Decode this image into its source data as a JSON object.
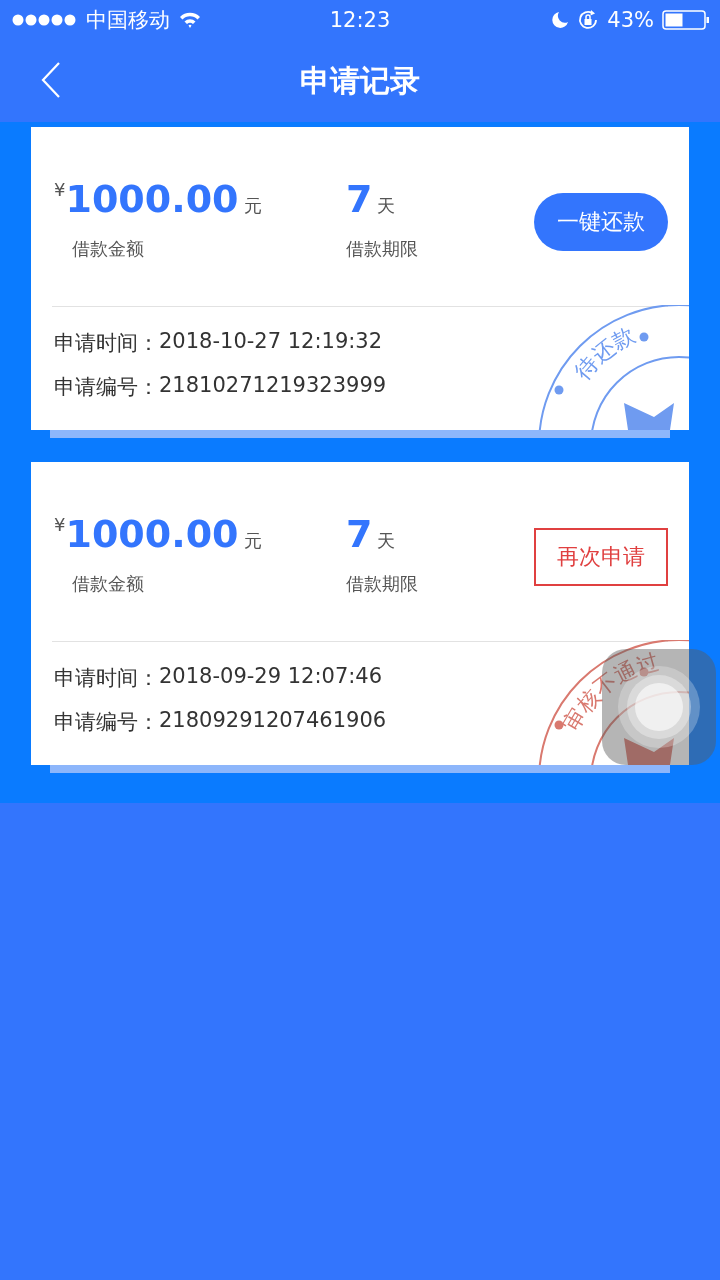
{
  "status_bar": {
    "carrier": "中国移动",
    "time": "12:23",
    "battery": "43%"
  },
  "header": {
    "title": "申请记录"
  },
  "records": [
    {
      "currency": "¥",
      "amount": "1000.00",
      "amount_unit": "元",
      "amount_label": "借款金额",
      "term": "7",
      "term_unit": "天",
      "term_label": "借款期限",
      "action": {
        "kind": "filled",
        "label": "一键还款"
      },
      "time_label": "申请时间：",
      "time": "2018-10-27 12:19:32",
      "number_label": "申请编号：",
      "number": "21810271219323999",
      "stamp": {
        "kind": "pending",
        "text": "待还款"
      }
    },
    {
      "currency": "¥",
      "amount": "1000.00",
      "amount_unit": "元",
      "amount_label": "借款金额",
      "term": "7",
      "term_unit": "天",
      "term_label": "借款期限",
      "action": {
        "kind": "outlined",
        "label": "再次申请"
      },
      "time_label": "申请时间：",
      "time": "2018-09-29 12:07:46",
      "number_label": "申请编号：",
      "number": "21809291207461906",
      "stamp": {
        "kind": "rejected",
        "text": "审核不通过"
      }
    }
  ]
}
